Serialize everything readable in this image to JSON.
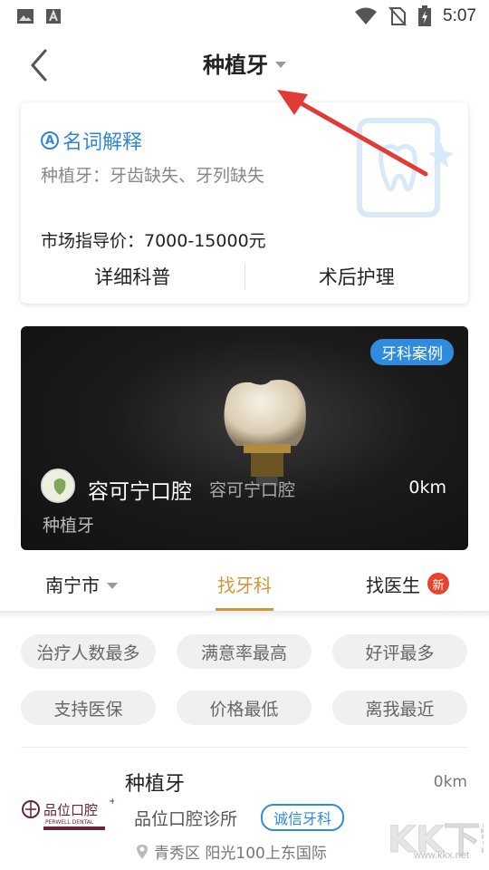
{
  "status_bar": {
    "time": "5:07",
    "icons": [
      "image-icon",
      "text-a-icon",
      "wifi-icon",
      "no-sim-icon",
      "battery-charging-icon"
    ]
  },
  "header": {
    "title": "种植牙",
    "back_icon": "chevron-left-icon",
    "dropdown_icon": "caret-down-icon"
  },
  "term_card": {
    "heading_icon": "circle-a-icon",
    "heading": "名词解释",
    "definition": "种植牙：牙齿缺失、牙列缺失",
    "price": "市场指导价：7000-15000元",
    "actions": [
      "详细科普",
      "术后护理"
    ]
  },
  "banner": {
    "tag": "牙科案例",
    "clinic_name": "容可宁口腔",
    "clinic_sub": "容可宁口腔",
    "distance": "0km",
    "procedure": "种植牙"
  },
  "tabs": [
    {
      "label": "南宁市",
      "has_dropdown": true
    },
    {
      "label": "找牙科",
      "active": true
    },
    {
      "label": "找医生",
      "badge": "新"
    }
  ],
  "filters": [
    "治疗人数最多",
    "满意率最高",
    "好评最多",
    "支持医保",
    "价格最低",
    "离我最近"
  ],
  "result": {
    "title": "种植牙",
    "distance": "0km",
    "clinic": "品位口腔诊所",
    "tag": "诚信牙科",
    "address": "青秀区 阳光100上东国际",
    "logo_text": "品位口腔",
    "logo_sub": "PERWELL DENTAL"
  },
  "watermark": {
    "text": "KK下载",
    "url": "www.kkx.net"
  },
  "colors": {
    "accent_blue": "#2e8bde",
    "tab_active": "#d3953a",
    "badge_red": "#e8432d",
    "arrow_red": "#e23b35"
  }
}
